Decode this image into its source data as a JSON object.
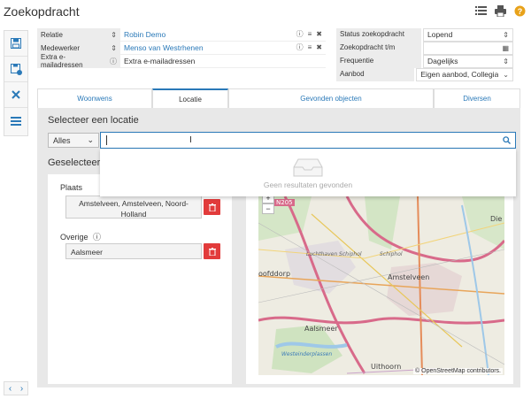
{
  "app": {
    "title": "Zoekopdracht"
  },
  "fields_left": [
    {
      "label": "Relatie",
      "value": "Robin Demo"
    },
    {
      "label": "Medewerker",
      "value": "Menso van Westrhenen"
    },
    {
      "label": "Extra e-mailadressen",
      "value": "Extra e-mailadressen"
    }
  ],
  "fields_right": [
    {
      "label": "Status zoekopdracht",
      "value": "Lopend"
    },
    {
      "label": "Zoekopdracht t/m",
      "value": ""
    },
    {
      "label": "Frequentie",
      "value": "Dagelijks"
    },
    {
      "label": "Aanbod",
      "value": "Eigen aanbod, Collegia"
    }
  ],
  "tabs": [
    "Woonwens",
    "Locatie",
    "Gevonden objecten",
    "Diversen"
  ],
  "locatie": {
    "heading": "Selecteer een locatie",
    "scope": "Alles",
    "search_value": "",
    "no_results": "Geen resultaten gevonden",
    "selected_heading": "Geselecteerde",
    "plaats_label": "Plaats",
    "plaats_value": "Amstelveen, Amstelveen, Noord-Holland",
    "overige_label": "Overige",
    "overige_value": "Aalsmeer"
  },
  "map": {
    "labels": [
      "Amstelveen",
      "Aalsmeer",
      "Uithoorn",
      "Schiphol",
      "Luchthaven Schiphol",
      "oofddorp",
      "Die",
      "Westeinderplassen",
      "N205"
    ],
    "attribution": "© OpenStreetMap contributors.",
    "zoom_in": "+",
    "zoom_out": "−"
  }
}
